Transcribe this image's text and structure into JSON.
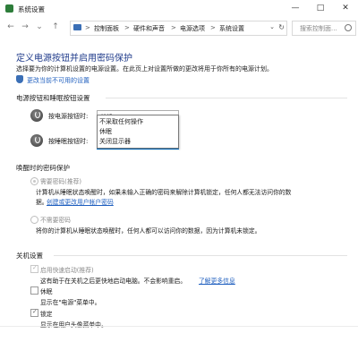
{
  "window": {
    "title": "系统设置",
    "minimize_glyph": "—",
    "maximize_glyph": "□",
    "close_glyph": "✕"
  },
  "nav": {
    "back_glyph": "←",
    "forward_glyph": "→",
    "recent_glyph": "⌄",
    "up_glyph": "↑",
    "breadcrumbs": [
      "控制面板",
      "硬件和声音",
      "电源选项",
      "系统设置"
    ],
    "separator": ">",
    "dropdown_glyph": "⌄",
    "refresh_glyph": "↻",
    "search_placeholder": "搜索控制面..."
  },
  "page": {
    "title": "定义电源按钮并启用密码保护",
    "description": "选择要为你的计算机设置的电源设置。在此页上对设置所做的更改将用于你所有的电源计划。",
    "change_link": "更改当前不可用的设置"
  },
  "power_buttons": {
    "section_title": "电源按钮和睡眠按钮设置",
    "power_label": "按电源按钮时:",
    "power_value": "关机",
    "sleep_label": "按睡眠按钮时:",
    "sleep_value": "",
    "chevron": "⌄",
    "dropdown_options": [
      "不采取任何操作",
      "休眠",
      "关闭显示器"
    ]
  },
  "password": {
    "section_title": "唤醒时的密码保护",
    "require_label": "需要密码(推荐)",
    "require_desc_1": "计算机从睡眠状态唤醒时，如果未输入正确的密码来解除计算机锁定，任何人都无法访问你的数",
    "require_desc_2": "据。",
    "require_link": "创建或更改用户帐户密码",
    "no_require_label": "不需要密码",
    "no_require_desc": "将你的计算机从睡眠状态唤醒时，任何人都可以访问你的数据，因为计算机未锁定。"
  },
  "shutdown": {
    "section_title": "关机设置",
    "fast_startup_label": "启用快速启动(推荐)",
    "fast_startup_desc": "这有助于在关机之后更快地启动电脑。不会影响重启。",
    "fast_startup_link": "了解更多信息",
    "hibernate_label": "休眠",
    "hibernate_desc": "显示在\"电源\"菜单中。",
    "lock_label": "锁定",
    "lock_desc": "显示在用户头像菜单中。",
    "check_glyph": "✓"
  },
  "colors": {
    "title_blue": "#1e3a8a",
    "link_blue": "#1f5fbf",
    "focus_blue": "#0078d7"
  }
}
